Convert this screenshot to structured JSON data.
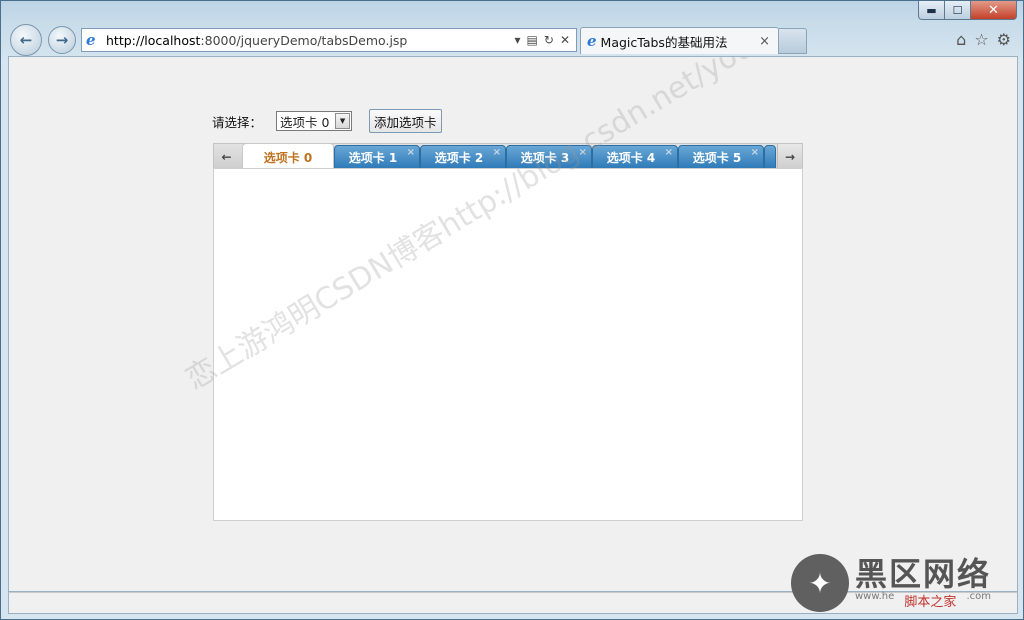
{
  "browser": {
    "url_host": "http://localhost",
    "url_rest": ":8000/jqueryDemo/tabsDemo.jsp",
    "tab_title": "MagicTabs的基础用法",
    "tab_close": "×"
  },
  "window_controls": {
    "min": "▬",
    "max": "☐",
    "close": "✕"
  },
  "page": {
    "select_label": "请选择：",
    "select_value": "选项卡 0",
    "add_button": "添加选项卡",
    "tabs": [
      {
        "label": "选项卡 0",
        "active": true
      },
      {
        "label": "选项卡 1",
        "active": false
      },
      {
        "label": "选项卡 2",
        "active": false
      },
      {
        "label": "选项卡 3",
        "active": false
      },
      {
        "label": "选项卡 4",
        "active": false
      },
      {
        "label": "选项卡 5",
        "active": false
      }
    ],
    "scroll_left": "←",
    "scroll_right": "→",
    "tab_close": "×"
  },
  "watermark": "恋上游鸿明CSDN博客http://blog.csdn.net/youqishini",
  "logo": {
    "big": "黑区网络",
    "sub_left": "www.he",
    "sub_right": "脚本之家",
    "sub_tail": ".com"
  },
  "colors": {
    "active_tab_text": "#c0711f",
    "tab_blue": "#2f7bb8"
  }
}
